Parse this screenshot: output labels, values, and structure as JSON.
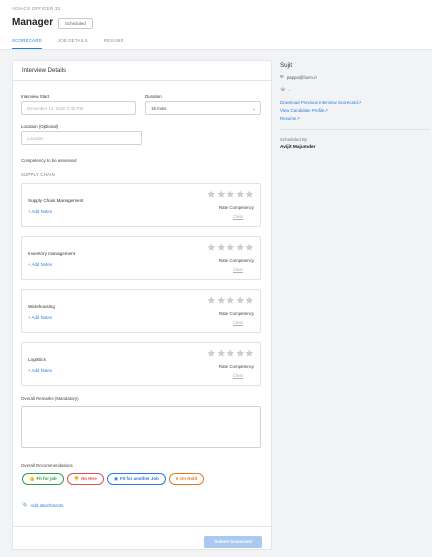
{
  "header": {
    "breadcrumb": "ADIACS OFFICER 32",
    "title": "Manager",
    "status_badge": "Scheduled",
    "tabs": [
      {
        "label": "SCORECARD",
        "active": true
      },
      {
        "label": "JOB DETAILS",
        "active": false
      },
      {
        "label": "RESUME",
        "active": false
      }
    ]
  },
  "form": {
    "card_title": "Interview Details",
    "interview_start_label": "Interview Start",
    "interview_start_value": "December 12, 2020 3:30 PM",
    "duration_label": "Duration",
    "duration_value": "15 mins",
    "location_label": "Location (Optional)",
    "location_placeholder": "Location",
    "competency_title": "Competency to be assessed",
    "competency_group": "SUPPLY CHAIN",
    "competencies": [
      {
        "name": "Supply Chain Management",
        "add_notes": "+ Add Notes",
        "rate_label": "Rate Competency",
        "clear": "Clear",
        "rating": 0
      },
      {
        "name": "Inventory management",
        "add_notes": "+ Add Notes",
        "rate_label": "Rate Competency",
        "clear": "Clear",
        "rating": 0
      },
      {
        "name": "Warehousing",
        "add_notes": "+ Add Notes",
        "rate_label": "Rate Competency",
        "clear": "Clear",
        "rating": 0
      },
      {
        "name": "Logistics",
        "add_notes": "+ Add Notes",
        "rate_label": "Rate Competency",
        "clear": "Clear",
        "rating": 0
      }
    ],
    "remarks_label": "Overall Remarks (Mandatory)",
    "recommendations_label": "Overall Recommendations",
    "recommendations": [
      {
        "label": "Fit for job",
        "icon": "thumbs-up-icon",
        "color": "#2e9f45"
      },
      {
        "label": "No Hire",
        "icon": "thumbs-down-icon",
        "color": "#e0504d"
      },
      {
        "label": "Fit for another Job",
        "icon": "briefcase-icon",
        "color": "#2a7be4"
      },
      {
        "label": "On Hold",
        "icon": "pause-icon",
        "color": "#e07b2c"
      }
    ],
    "attachments_label": "Add attachments",
    "submit_label": "Submit Scorecard"
  },
  "candidate": {
    "name": "Sujit",
    "email": "pappu@fovm.rr",
    "phone": "-",
    "links": [
      "Download Previous Interview Scorecard↗",
      "View Candidate Profile↗",
      "Resume↗"
    ],
    "scheduled_by_label": "Scheduled By",
    "scheduled_by_name": "Avijit Majumder"
  },
  "colors": {
    "accent": "#2a7be4",
    "star_empty": "#c9ccd1"
  }
}
